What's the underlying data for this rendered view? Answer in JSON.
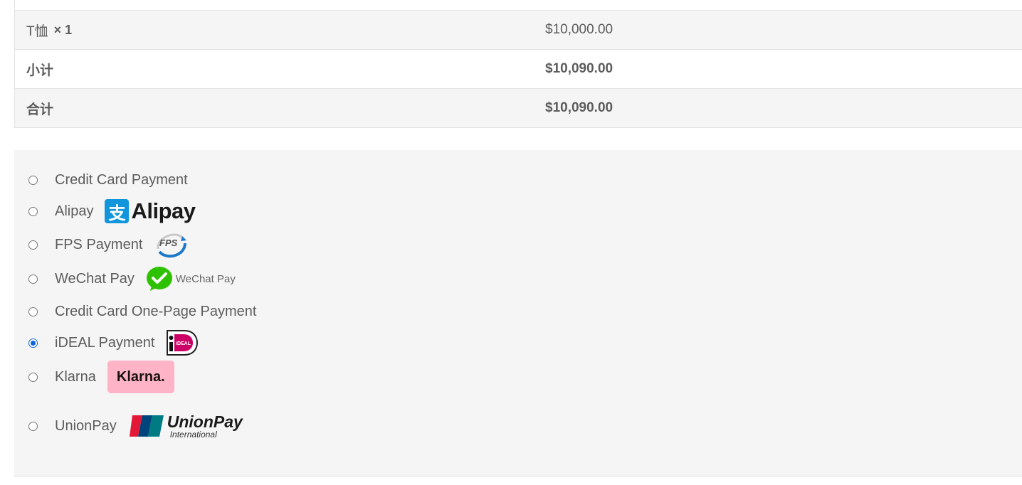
{
  "order": {
    "item": {
      "name": "T恤",
      "qty": "× 1",
      "price": "$10,000.00"
    },
    "subtotal": {
      "label": "小计",
      "value": "$10,090.00"
    },
    "total": {
      "label": "合计",
      "value": "$10,090.00"
    }
  },
  "payment_methods": [
    {
      "label": "Credit Card Payment",
      "checked": false,
      "logo": ""
    },
    {
      "label": "Alipay",
      "checked": false,
      "logo": "alipay-logo",
      "logo_text": "Alipay",
      "logo_mark": "支"
    },
    {
      "label": "FPS Payment",
      "checked": false,
      "logo": "fps-logo",
      "logo_text": "FPS"
    },
    {
      "label": "WeChat Pay",
      "checked": false,
      "logo": "wechat-pay-logo",
      "logo_text": "WeChat Pay"
    },
    {
      "label": "Credit Card One-Page Payment",
      "checked": false,
      "logo": ""
    },
    {
      "label": "iDEAL Payment",
      "checked": true,
      "logo": "ideal-logo",
      "logo_text": "iDEAL"
    },
    {
      "label": "Klarna",
      "checked": false,
      "logo": "klarna-logo",
      "logo_text": "Klarna."
    },
    {
      "label": "UnionPay",
      "checked": false,
      "logo": "unionpay-logo",
      "logo_text": "UnionPay",
      "logo_sub": "International"
    }
  ],
  "colors": {
    "accent": "#0b64d8",
    "alipay": "#1296db",
    "wechat": "#2dc100",
    "ideal": "#cc0066",
    "klarna": "#ffb3c7"
  }
}
